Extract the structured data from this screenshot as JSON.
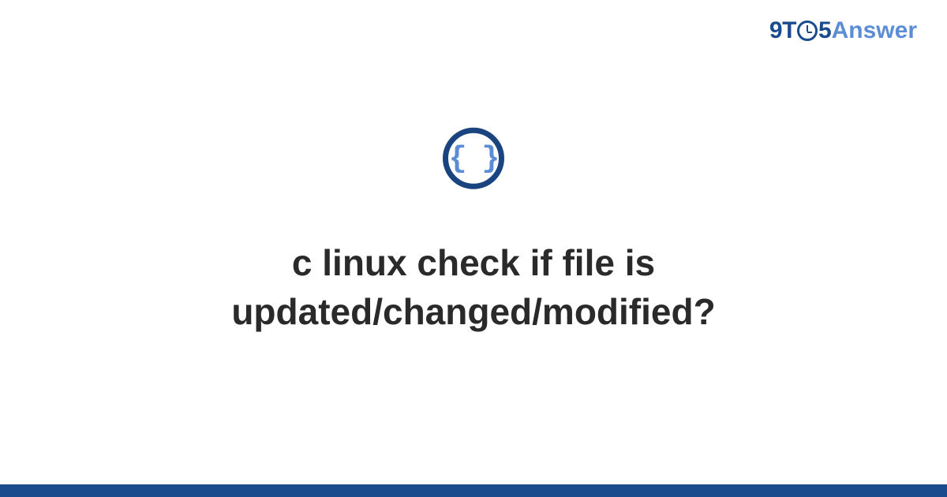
{
  "logo": {
    "part1": "9T",
    "part2": "5",
    "part3": "Answer"
  },
  "icon": {
    "braces": "{ }"
  },
  "title": {
    "line1": "c linux check if file is",
    "line2": "updated/changed/modified?"
  },
  "colors": {
    "primary": "#1a4b8c",
    "accent": "#5a8dd6",
    "text": "#2a2a2a"
  }
}
